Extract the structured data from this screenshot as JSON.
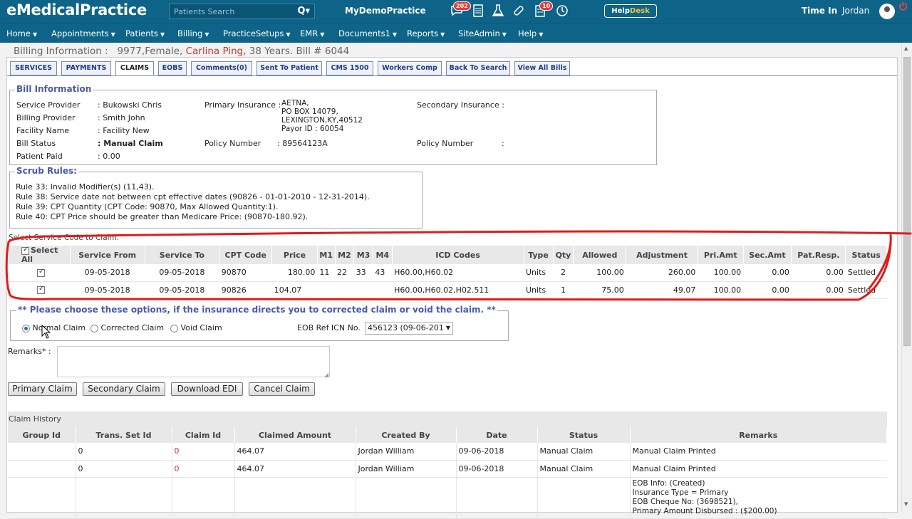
{
  "topbar": {
    "logo": "eMedicalPractice",
    "search_placeholder": "Patients Search",
    "practice": "MyDemoPractice",
    "badge_messages": "202",
    "badge_tasks": "10",
    "help_text": "Help",
    "desk_text": "Desk",
    "time_in": "Time In",
    "user": "Jordan"
  },
  "nav": [
    "Home",
    "Appointments",
    "Patients",
    "Billing",
    "PracticeSetups",
    "EMR",
    "Documents1",
    "Reports",
    "SiteAdmin",
    "Help"
  ],
  "billing_header": {
    "prefix": "Billing Information :",
    "patient_info": "9977,Female,",
    "patient_name": "Carlina Ping,",
    "suffix": "38 Years.   Bill # 6044"
  },
  "tabs": [
    "SERVICES",
    "PAYMENTS",
    "CLAIMS",
    "EOBS",
    "Comments(0)",
    "Sent To Patient",
    "CMS 1500",
    "Workers Comp",
    "Back To Search",
    "View All Bills"
  ],
  "bill_info": {
    "legend": "Bill Information",
    "service_provider_label": "Service Provider",
    "service_provider": ": Bukowski Chris",
    "billing_provider_label": "Billing Provider",
    "billing_provider": ": Smith John",
    "facility_label": "Facility Name",
    "facility": ": Facility New",
    "bill_status_label": "Bill Status",
    "bill_status": ": Manual Claim",
    "patient_paid_label": "Patient Paid",
    "patient_paid": ": 0.00",
    "primary_ins_label": "Primary Insurance :",
    "primary_ins_line1": "AETNA,",
    "primary_ins_line2": "PO BOX 14079,",
    "primary_ins_line3": "LEXINGTON,KY,40512",
    "primary_ins_line4": "Payor ID : 60054",
    "policy_label": "Policy Number",
    "policy_value": ": 89564123A",
    "secondary_ins_label": "Secondary Insurance :",
    "policy2_label": "Policy Number",
    "policy2_value": ":"
  },
  "scrub": {
    "legend": "Scrub Rules:",
    "rules": [
      "Rule 33: Invalid Modifier(s) (11,43).",
      "Rule 38: Service date not between cpt effective dates (90826 - 01-01-2010 - 12-31-2014).",
      "Rule 39: CPT Quantity (CPT Code: 90870, Max Allowed Quantity:1).",
      "Rule 40: CPT Price should be greater than Medicare Price: (90870-180.92)."
    ]
  },
  "services": {
    "title": "Select Service Code to Claim.",
    "headers": [
      "Select All",
      "Service From",
      "Service To",
      "CPT Code",
      "Price",
      "M1",
      "M2",
      "M3",
      "M4",
      "ICD Codes",
      "Type",
      "Qty",
      "Allowed",
      "Adjustment",
      "Pri.Amt",
      "Sec.Amt",
      "Pat.Resp.",
      "Status"
    ],
    "rows": [
      [
        "09-05-2018",
        "09-05-2018",
        "90870",
        "180.00",
        "11",
        "22",
        "33",
        "43",
        "H60.00,H60.02",
        "Units",
        "2",
        "100.00",
        "260.00",
        "100.00",
        "0.00",
        "0.00",
        "Settled"
      ],
      [
        "09-05-2018",
        "09-05-2018",
        "90826",
        "104.07",
        "",
        "",
        "",
        "",
        "H60.00,H60.02,H02.511",
        "Units",
        "1",
        "75.00",
        "49.07",
        "100.00",
        "0.00",
        "0.00",
        "Settled"
      ]
    ]
  },
  "options": {
    "legend": "** Please choose these options, if the insurance directs you to corrected claim or void the claim. **",
    "normal": "Normal Claim",
    "corrected": "Corrected Claim",
    "void": "Void Claim",
    "eob_label": "EOB Ref ICN No.",
    "eob_value": "456123 (09-06-201"
  },
  "remarks_label": "Remarks* :",
  "buttons": {
    "primary": "Primary Claim",
    "secondary": "Secondary Claim",
    "edi": "Download EDI",
    "cancel": "Cancel Claim"
  },
  "history": {
    "title": "Claim History",
    "headers": [
      "Group Id",
      "Trans. Set Id",
      "Claim Id",
      "Claimed Amount",
      "Created By",
      "Date",
      "Status",
      "Remarks"
    ],
    "rows": [
      [
        "",
        "0",
        "0",
        "464.07",
        "Jordan William",
        "09-06-2018",
        "Manual Claim",
        "Manual Claim Printed"
      ],
      [
        "",
        "0",
        "0",
        "464.07",
        "Jordan William",
        "09-06-2018",
        "Manual Claim",
        "Manual Claim Printed"
      ]
    ],
    "eob_lines": [
      "EOB Info: (Created)",
      "Insurance Type = Primary",
      "EOB Cheque No: (3698521),",
      "Primary Amount Disbursed : ($200.00)"
    ]
  },
  "colors": {
    "brand": "#0d6488",
    "tab_text": "#1e3a8a",
    "annotation": "#e21b1b"
  }
}
